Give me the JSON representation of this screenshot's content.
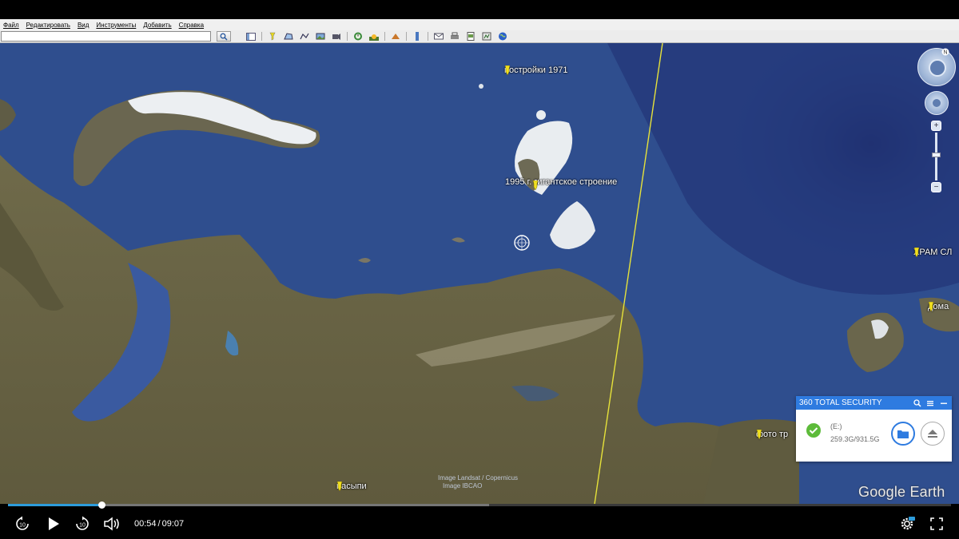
{
  "menu": {
    "items": [
      "Файл",
      "Редактировать",
      "Вид",
      "Инструменты",
      "Добавить",
      "Справка"
    ]
  },
  "toolbar": {
    "search_value": "",
    "icons": [
      "sidebar-toggle-icon",
      "add-placemark-icon",
      "add-polygon-icon",
      "add-path-icon",
      "add-image-overlay-icon",
      "record-tour-icon",
      "historical-imagery-icon",
      "sunlight-icon",
      "planets-icon",
      "ruler-icon",
      "email-icon",
      "print-icon",
      "save-image-icon",
      "view-in-maps-icon",
      "earth-icon"
    ]
  },
  "map": {
    "placemarks": [
      {
        "label": "постройки 1971"
      },
      {
        "label": "1995 г. гигантское строение"
      },
      {
        "label": "ХРАМ СЛ"
      },
      {
        "label": "дома"
      },
      {
        "label": "фото тр"
      },
      {
        "label": "насыпи"
      }
    ],
    "attribution": [
      "Image Landsat / Copernicus",
      "Image IBCAO"
    ],
    "logo": "Google Earth",
    "colors": {
      "ocean": "#2e4c8d",
      "land": "#6b6646",
      "ice": "#f2f2f2",
      "border_line": "#e6e23a",
      "pin": "#f0e020"
    }
  },
  "security_popup": {
    "title": "360 TOTAL SECURITY",
    "drive": "(E:)",
    "size": "259.3G/931.5G",
    "accent": "#2e7be0",
    "ok_color": "#5dbb3a"
  },
  "player": {
    "current_time": "00:54",
    "duration": "09:07",
    "progress_fraction": 0.099,
    "buffer_fraction": 0.51,
    "accent": "#2d9cdb",
    "skip_seconds": "10"
  }
}
